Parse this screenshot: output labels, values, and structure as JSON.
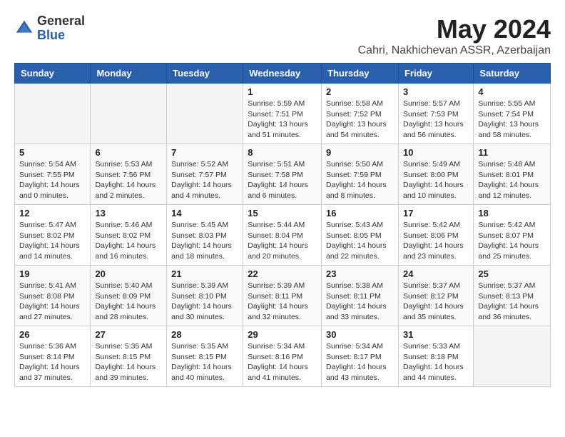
{
  "logo": {
    "general": "General",
    "blue": "Blue"
  },
  "title": {
    "month": "May 2024",
    "location": "Cahri, Nakhichevan ASSR, Azerbaijan"
  },
  "weekdays": [
    "Sunday",
    "Monday",
    "Tuesday",
    "Wednesday",
    "Thursday",
    "Friday",
    "Saturday"
  ],
  "weeks": [
    [
      {
        "day": "",
        "sunrise": "",
        "sunset": "",
        "daylight": ""
      },
      {
        "day": "",
        "sunrise": "",
        "sunset": "",
        "daylight": ""
      },
      {
        "day": "",
        "sunrise": "",
        "sunset": "",
        "daylight": ""
      },
      {
        "day": "1",
        "sunrise": "Sunrise: 5:59 AM",
        "sunset": "Sunset: 7:51 PM",
        "daylight": "Daylight: 13 hours and 51 minutes."
      },
      {
        "day": "2",
        "sunrise": "Sunrise: 5:58 AM",
        "sunset": "Sunset: 7:52 PM",
        "daylight": "Daylight: 13 hours and 54 minutes."
      },
      {
        "day": "3",
        "sunrise": "Sunrise: 5:57 AM",
        "sunset": "Sunset: 7:53 PM",
        "daylight": "Daylight: 13 hours and 56 minutes."
      },
      {
        "day": "4",
        "sunrise": "Sunrise: 5:55 AM",
        "sunset": "Sunset: 7:54 PM",
        "daylight": "Daylight: 13 hours and 58 minutes."
      }
    ],
    [
      {
        "day": "5",
        "sunrise": "Sunrise: 5:54 AM",
        "sunset": "Sunset: 7:55 PM",
        "daylight": "Daylight: 14 hours and 0 minutes."
      },
      {
        "day": "6",
        "sunrise": "Sunrise: 5:53 AM",
        "sunset": "Sunset: 7:56 PM",
        "daylight": "Daylight: 14 hours and 2 minutes."
      },
      {
        "day": "7",
        "sunrise": "Sunrise: 5:52 AM",
        "sunset": "Sunset: 7:57 PM",
        "daylight": "Daylight: 14 hours and 4 minutes."
      },
      {
        "day": "8",
        "sunrise": "Sunrise: 5:51 AM",
        "sunset": "Sunset: 7:58 PM",
        "daylight": "Daylight: 14 hours and 6 minutes."
      },
      {
        "day": "9",
        "sunrise": "Sunrise: 5:50 AM",
        "sunset": "Sunset: 7:59 PM",
        "daylight": "Daylight: 14 hours and 8 minutes."
      },
      {
        "day": "10",
        "sunrise": "Sunrise: 5:49 AM",
        "sunset": "Sunset: 8:00 PM",
        "daylight": "Daylight: 14 hours and 10 minutes."
      },
      {
        "day": "11",
        "sunrise": "Sunrise: 5:48 AM",
        "sunset": "Sunset: 8:01 PM",
        "daylight": "Daylight: 14 hours and 12 minutes."
      }
    ],
    [
      {
        "day": "12",
        "sunrise": "Sunrise: 5:47 AM",
        "sunset": "Sunset: 8:02 PM",
        "daylight": "Daylight: 14 hours and 14 minutes."
      },
      {
        "day": "13",
        "sunrise": "Sunrise: 5:46 AM",
        "sunset": "Sunset: 8:02 PM",
        "daylight": "Daylight: 14 hours and 16 minutes."
      },
      {
        "day": "14",
        "sunrise": "Sunrise: 5:45 AM",
        "sunset": "Sunset: 8:03 PM",
        "daylight": "Daylight: 14 hours and 18 minutes."
      },
      {
        "day": "15",
        "sunrise": "Sunrise: 5:44 AM",
        "sunset": "Sunset: 8:04 PM",
        "daylight": "Daylight: 14 hours and 20 minutes."
      },
      {
        "day": "16",
        "sunrise": "Sunrise: 5:43 AM",
        "sunset": "Sunset: 8:05 PM",
        "daylight": "Daylight: 14 hours and 22 minutes."
      },
      {
        "day": "17",
        "sunrise": "Sunrise: 5:42 AM",
        "sunset": "Sunset: 8:06 PM",
        "daylight": "Daylight: 14 hours and 23 minutes."
      },
      {
        "day": "18",
        "sunrise": "Sunrise: 5:42 AM",
        "sunset": "Sunset: 8:07 PM",
        "daylight": "Daylight: 14 hours and 25 minutes."
      }
    ],
    [
      {
        "day": "19",
        "sunrise": "Sunrise: 5:41 AM",
        "sunset": "Sunset: 8:08 PM",
        "daylight": "Daylight: 14 hours and 27 minutes."
      },
      {
        "day": "20",
        "sunrise": "Sunrise: 5:40 AM",
        "sunset": "Sunset: 8:09 PM",
        "daylight": "Daylight: 14 hours and 28 minutes."
      },
      {
        "day": "21",
        "sunrise": "Sunrise: 5:39 AM",
        "sunset": "Sunset: 8:10 PM",
        "daylight": "Daylight: 14 hours and 30 minutes."
      },
      {
        "day": "22",
        "sunrise": "Sunrise: 5:39 AM",
        "sunset": "Sunset: 8:11 PM",
        "daylight": "Daylight: 14 hours and 32 minutes."
      },
      {
        "day": "23",
        "sunrise": "Sunrise: 5:38 AM",
        "sunset": "Sunset: 8:11 PM",
        "daylight": "Daylight: 14 hours and 33 minutes."
      },
      {
        "day": "24",
        "sunrise": "Sunrise: 5:37 AM",
        "sunset": "Sunset: 8:12 PM",
        "daylight": "Daylight: 14 hours and 35 minutes."
      },
      {
        "day": "25",
        "sunrise": "Sunrise: 5:37 AM",
        "sunset": "Sunset: 8:13 PM",
        "daylight": "Daylight: 14 hours and 36 minutes."
      }
    ],
    [
      {
        "day": "26",
        "sunrise": "Sunrise: 5:36 AM",
        "sunset": "Sunset: 8:14 PM",
        "daylight": "Daylight: 14 hours and 37 minutes."
      },
      {
        "day": "27",
        "sunrise": "Sunrise: 5:35 AM",
        "sunset": "Sunset: 8:15 PM",
        "daylight": "Daylight: 14 hours and 39 minutes."
      },
      {
        "day": "28",
        "sunrise": "Sunrise: 5:35 AM",
        "sunset": "Sunset: 8:15 PM",
        "daylight": "Daylight: 14 hours and 40 minutes."
      },
      {
        "day": "29",
        "sunrise": "Sunrise: 5:34 AM",
        "sunset": "Sunset: 8:16 PM",
        "daylight": "Daylight: 14 hours and 41 minutes."
      },
      {
        "day": "30",
        "sunrise": "Sunrise: 5:34 AM",
        "sunset": "Sunset: 8:17 PM",
        "daylight": "Daylight: 14 hours and 43 minutes."
      },
      {
        "day": "31",
        "sunrise": "Sunrise: 5:33 AM",
        "sunset": "Sunset: 8:18 PM",
        "daylight": "Daylight: 14 hours and 44 minutes."
      },
      {
        "day": "",
        "sunrise": "",
        "sunset": "",
        "daylight": ""
      }
    ]
  ]
}
